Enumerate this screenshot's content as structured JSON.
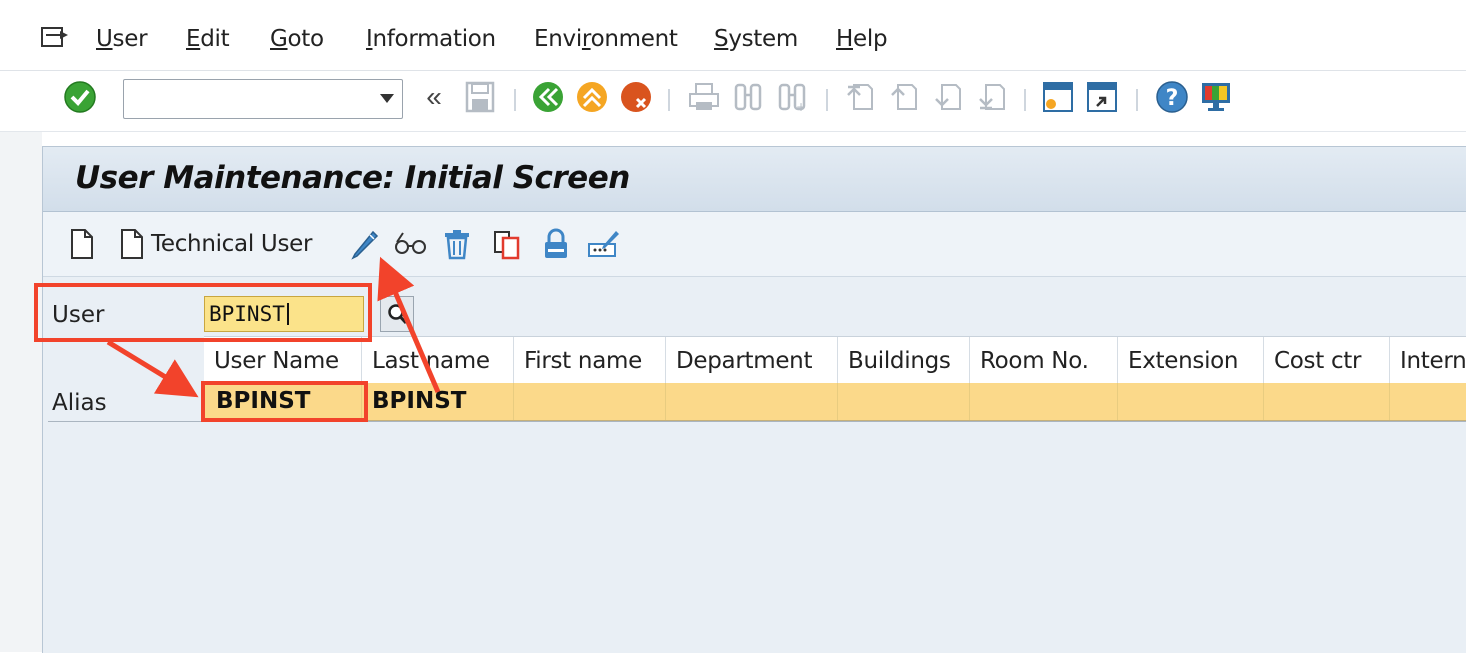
{
  "menu": {
    "items": [
      {
        "label": "User",
        "ul": "U",
        "rest": "ser"
      },
      {
        "label": "Edit",
        "ul": "E",
        "rest": "dit"
      },
      {
        "label": "Goto",
        "ul": "G",
        "rest": "oto"
      },
      {
        "label": "Information",
        "ul": "I",
        "rest": "nformation"
      },
      {
        "label": "Environment",
        "pre": "Envi",
        "ul": "r",
        "rest": "onment"
      },
      {
        "label": "System",
        "ul": "S",
        "rest": "ystem"
      },
      {
        "label": "Help",
        "ul": "H",
        "rest": "elp"
      }
    ]
  },
  "toolbar": {
    "command_field_value": "",
    "back_double_label": "«"
  },
  "screen": {
    "title": "User Maintenance: Initial Screen",
    "appbar": {
      "technical_user_label": "Technical User"
    }
  },
  "fields": {
    "user_label": "User",
    "user_value": "BPINST",
    "alias_label": "Alias"
  },
  "table": {
    "columns": [
      "User Name",
      "Last name",
      "First name",
      "Department",
      "Buildings",
      "Room No.",
      "Extension",
      "Cost ctr",
      "Intern"
    ],
    "rows": [
      [
        "BPINST",
        "BPINST",
        "",
        "",
        "",
        "",
        "",
        "",
        ""
      ]
    ]
  },
  "colors": {
    "accent_red": "#f2432b",
    "row_highlight": "#fbd98a",
    "input_highlight": "#fbe38a"
  }
}
